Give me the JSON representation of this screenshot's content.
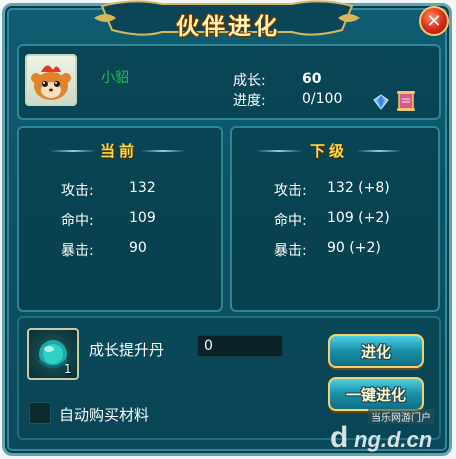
{
  "title": "伙伴进化",
  "pet": {
    "name": "小貂",
    "growth_label": "成长:",
    "growth_value": "60",
    "progress_label": "进度:",
    "progress_value": "0/100",
    "portrait_icon": "monkey-pet-portrait"
  },
  "current": {
    "header": "当前",
    "stats": [
      {
        "label": "攻击:",
        "value": "132"
      },
      {
        "label": "命中:",
        "value": "109"
      },
      {
        "label": "暴击:",
        "value": "90"
      }
    ]
  },
  "next": {
    "header": "下级",
    "stats": [
      {
        "label": "攻击:",
        "value": "132 (+8)"
      },
      {
        "label": "命中:",
        "value": "109 (+2)"
      },
      {
        "label": "暴击:",
        "value": "90 (+2)"
      }
    ]
  },
  "material": {
    "name": "成长提升丹",
    "count": "1",
    "quantity_input": "0",
    "icon": "green-orb-icon"
  },
  "buttons": {
    "evolve": "进化",
    "one_key_evolve": "一键进化"
  },
  "auto_buy_label": "自动购买材料",
  "watermark": {
    "text": "当乐网游门户",
    "logo": "d ng.d.cn"
  },
  "colors": {
    "panel_bg": "#0c5467",
    "accent_gold": "#ffd54a",
    "pet_name_green": "#1fc24a",
    "close_red": "#d62a12"
  }
}
